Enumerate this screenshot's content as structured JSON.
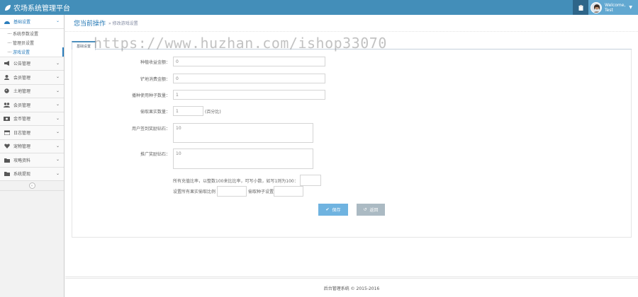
{
  "app": {
    "title": "农场系统管理平台"
  },
  "user": {
    "welcome": "Welcome,",
    "name": "Test"
  },
  "sidebar": {
    "items": [
      {
        "label": "基础设置",
        "icon": "dashboard-icon"
      },
      {
        "label": "公告管理",
        "icon": "megaphone-icon"
      },
      {
        "label": "会员管理",
        "icon": "user-icon"
      },
      {
        "label": "土地管理",
        "icon": "globe-icon"
      },
      {
        "label": "会员管理",
        "icon": "users-icon"
      },
      {
        "label": "金币管理",
        "icon": "cash-icon"
      },
      {
        "label": "日志管理",
        "icon": "calendar-icon"
      },
      {
        "label": "宠物管理",
        "icon": "heart-icon"
      },
      {
        "label": "攻略资料",
        "icon": "folder-icon"
      },
      {
        "label": "系统提现",
        "icon": "folder-icon"
      }
    ],
    "sub_items": [
      "系统参数设置",
      "管理员设置",
      "游戏设置"
    ],
    "collapse": "«"
  },
  "page": {
    "title": "您当前操作",
    "subtitle": "» 修改游戏设置",
    "tab": "基础设置"
  },
  "watermark": "https://www.huzhan.com/ishop33070",
  "form": {
    "f1": {
      "label": "种植收益金额：",
      "value": "0"
    },
    "f2": {
      "label": "铲地消费金额：",
      "value": "0"
    },
    "f3": {
      "label": "播种使用种子数量：",
      "value": "1"
    },
    "f4": {
      "label": "偷取果实数量：",
      "value": "1",
      "suffix": "(百分比)"
    },
    "f5": {
      "label": "用户签到奖励钻石：",
      "value": "10"
    },
    "f6": {
      "label": "推广奖励钻石：",
      "value": "10"
    },
    "note1": "所有充值比率，以整数100来比比率，可写小数，如写1则为100：",
    "note2a": "设置所有果实偷取比例",
    "note2b": "偷取种子设置"
  },
  "buttons": {
    "save": "保存",
    "back": "返回"
  },
  "footer": "后台管理系统 © 2015-2016"
}
